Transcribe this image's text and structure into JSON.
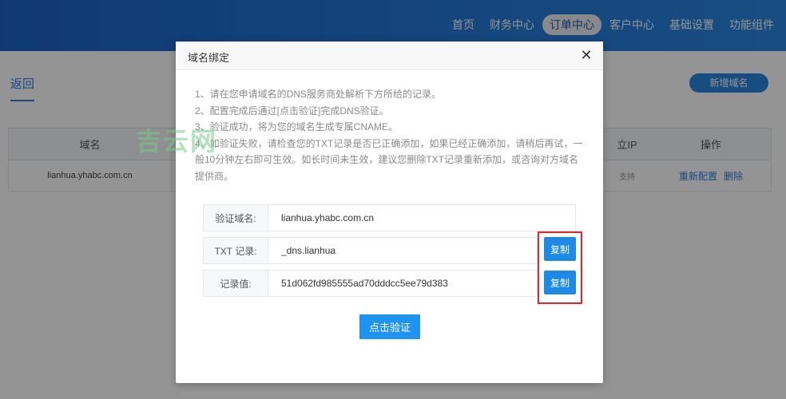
{
  "nav": {
    "items": [
      "首页",
      "财务中心",
      "订单中心",
      "客户中心",
      "基础设置",
      "功能组件"
    ],
    "active_index": 2
  },
  "page": {
    "back_label": "返回",
    "add_button_label": "新增域名",
    "table": {
      "headers": [
        "域名",
        "立IP",
        "操作"
      ],
      "rows": [
        {
          "domain": "lianhua.yhabc.com.cn",
          "ip_status": "支持",
          "reconfig": "重新配置",
          "delete": "删除"
        }
      ]
    }
  },
  "modal": {
    "title": "域名绑定",
    "close_symbol": "✕",
    "instructions": [
      "1、请在您申请域名的DNS服务商处解析下方所给的记录。",
      "2、配置完成后通过[点击验证]完成DNS验证。",
      "3、验证成功，将为您的域名生成专属CNAME。",
      "4、如验证失败，请检查您的TXT记录是否已正确添加，如果已经正确添加，请稍后再试，一般10分钟左右即可生效。如长时间未生效，建议您删除TXT记录重新添加，或咨询对方域名提供商。"
    ],
    "watermark": "吉云网",
    "fields": [
      {
        "label": "验证域名:",
        "value": "lianhua.yhabc.com.cn"
      },
      {
        "label": "TXT 记录:",
        "value": "_dns.lianhua",
        "copy_label": "复制"
      },
      {
        "label": "记录值:",
        "value": "51d062fd985555ad70dddcc5ee79d383",
        "copy_label": "复制"
      }
    ],
    "verify_button_label": "点击验证"
  },
  "colors": {
    "header_gradient_start": "#1d63c7",
    "header_gradient_end": "#2a86e0",
    "primary": "#1e8ae6",
    "highlight": "#e0252b"
  }
}
